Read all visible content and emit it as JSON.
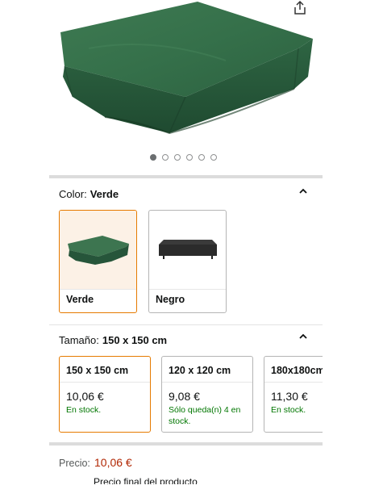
{
  "gallery": {
    "dot_count": 6,
    "active_dot": 0
  },
  "color_selector": {
    "label": "Color:",
    "selected": "Verde",
    "options": [
      {
        "name": "Verde",
        "selected": true
      },
      {
        "name": "Negro",
        "selected": false
      }
    ]
  },
  "size_selector": {
    "label": "Tamaño:",
    "selected": "150 x 150 cm",
    "options": [
      {
        "title": "150 x 150 cm",
        "price": "10,06 €",
        "stock": "En stock.",
        "selected": true
      },
      {
        "title": "120 x 120 cm",
        "price": "9,08 €",
        "stock": "Sólo queda(n) 4 en stock.",
        "selected": false
      },
      {
        "title": "180x180cm",
        "price": "11,30 €",
        "stock": "En stock.",
        "selected": false
      }
    ]
  },
  "price": {
    "label": "Precio:",
    "value": "10,06 €",
    "note": "Precio final del producto"
  },
  "colors": {
    "accent_border": "#e67a00",
    "price_red": "#b12704",
    "stock_green": "#007600"
  },
  "icons": {
    "share": "share-icon",
    "collapse": "chevron-up-icon"
  }
}
